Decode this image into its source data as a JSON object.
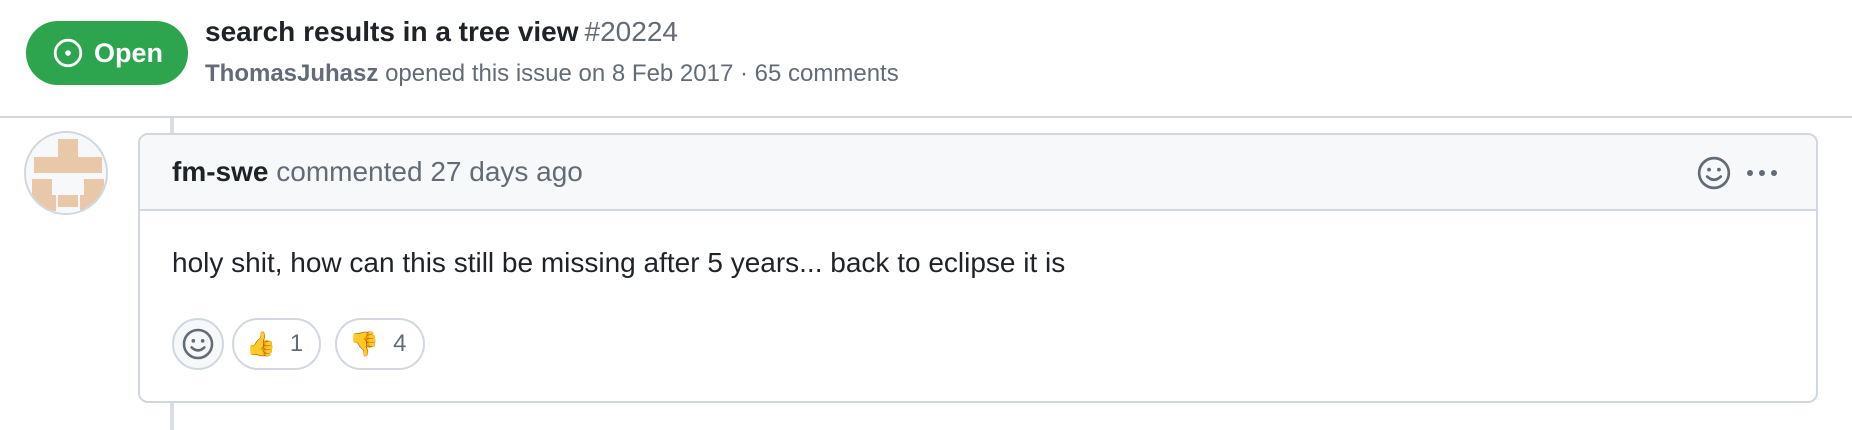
{
  "issue": {
    "state": "Open",
    "title": "search results in a tree view",
    "number": "#20224",
    "author": "ThomasJuhasz",
    "opened_text": "opened this issue on 8 Feb 2017 · 65 comments"
  },
  "comment": {
    "author": "fm-swe",
    "action_text": "commented 27 days ago",
    "body": "holy shit, how can this still be missing after 5 years... back to eclipse it is",
    "reactions": [
      {
        "emoji": "👍",
        "count": "1"
      },
      {
        "emoji": "👎",
        "count": "4"
      }
    ]
  },
  "colors": {
    "open_green": "#2da44e",
    "avatar_tan": "#e8c8a8",
    "border": "#d0d7de",
    "muted_text": "#636c76"
  },
  "icons": {
    "state": "issue-open-icon",
    "header_reaction": "smiley-icon",
    "header_menu": "kebab-horizontal-icon",
    "add_reaction": "smiley-icon"
  }
}
